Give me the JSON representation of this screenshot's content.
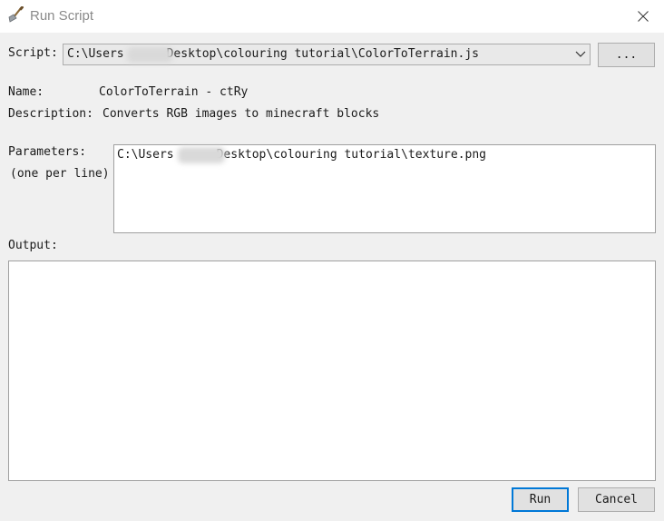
{
  "window": {
    "title": "Run Script",
    "icon": "shovel-icon",
    "close_icon": "close-icon"
  },
  "script": {
    "label": "Script:",
    "value_prefix": "C:\\Users",
    "value_suffix": "Desktop\\colouring tutorial\\ColorToTerrain.js",
    "browse_label": "..."
  },
  "info": {
    "name_label": "Name:",
    "name_value": "ColorToTerrain - ctRy",
    "description_label": "Description:",
    "description_value": "Converts RGB images to minecraft blocks"
  },
  "parameters": {
    "label": "Parameters:",
    "hint": "(one per line)",
    "value_prefix": "C:\\Users",
    "value_suffix": "Desktop\\colouring tutorial\\texture.png"
  },
  "output": {
    "label": "Output:",
    "value": ""
  },
  "buttons": {
    "run": "Run",
    "cancel": "Cancel"
  }
}
